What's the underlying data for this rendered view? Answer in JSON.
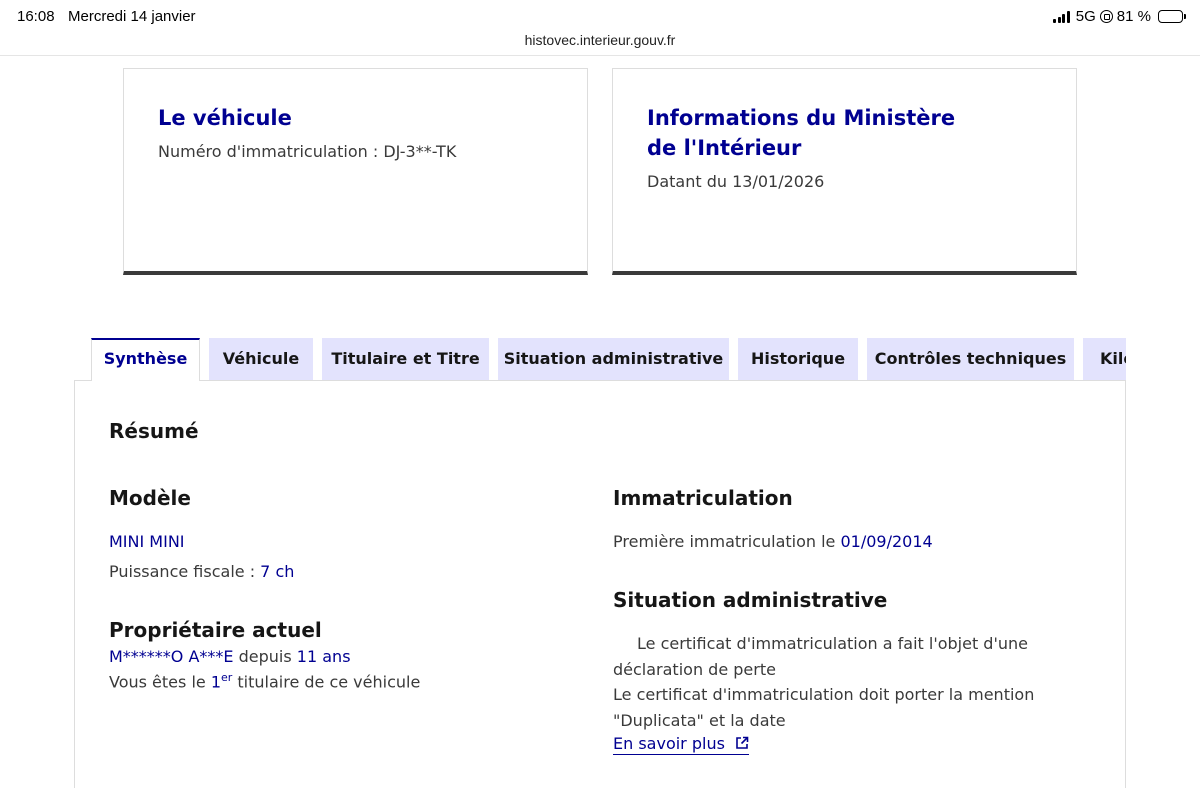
{
  "status_bar": {
    "time": "16:08",
    "date": "Mercredi 14 janvier",
    "network": "5G",
    "battery": "81 %",
    "battery_level": 0.81
  },
  "browser": {
    "url": "histovec.interieur.gouv.fr"
  },
  "cards": {
    "vehicle": {
      "title": "Le véhicule",
      "text": "Numéro d'immatriculation : DJ-3**-TK"
    },
    "ministry": {
      "title": "Informations du Ministère de l'Intérieur",
      "text": "Datant du 13/01/2026"
    }
  },
  "tabs": [
    {
      "label": "Synthèse",
      "active": true
    },
    {
      "label": "Véhicule",
      "active": false
    },
    {
      "label": "Titulaire et Titre",
      "active": false
    },
    {
      "label": "Situation administrative",
      "active": false
    },
    {
      "label": "Historique",
      "active": false
    },
    {
      "label": "Contrôles techniques",
      "active": false
    },
    {
      "label": "Kilométrage",
      "active": false
    }
  ],
  "summary": {
    "title": "Résumé",
    "model": {
      "title": "Modèle",
      "name": "MINI MINI",
      "fiscal_power_label": "Puissance fiscale : ",
      "fiscal_power_value": "7 ch"
    },
    "owner": {
      "title": "Propriétaire actuel",
      "name": "M******O A***E",
      "since_label": " depuis ",
      "since_value": "11 ans",
      "rank_prefix": "Vous êtes le ",
      "rank_number": "1",
      "rank_sup": "er",
      "rank_suffix": " titulaire de ce véhicule"
    },
    "registration": {
      "title": "Immatriculation",
      "first_label": "Première immatriculation le ",
      "first_date": "01/09/2014"
    },
    "admin_situation": {
      "title": "Situation administrative",
      "line1": "Le certificat d'immatriculation a fait l'objet d'une déclaration de perte",
      "line2": "Le certificat d'immatriculation doit porter la mention \"Duplicata\" et la date",
      "link": "En savoir plus"
    }
  }
}
